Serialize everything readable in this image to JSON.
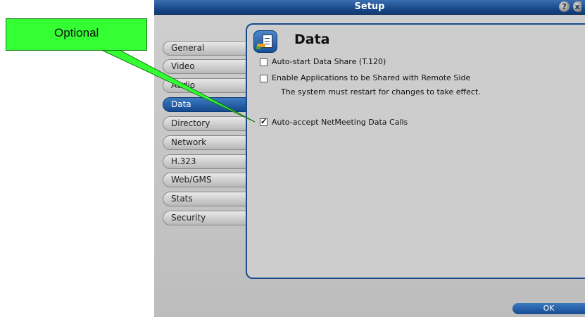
{
  "window": {
    "title": "Setup",
    "help_glyph": "?",
    "close_glyph": "x"
  },
  "sidebar": {
    "items": [
      {
        "label": "General"
      },
      {
        "label": "Video"
      },
      {
        "label": "Audio"
      },
      {
        "label": "Data",
        "active": true
      },
      {
        "label": "Directory"
      },
      {
        "label": "Network"
      },
      {
        "label": "H.323"
      },
      {
        "label": "Web/GMS"
      },
      {
        "label": "Stats"
      },
      {
        "label": "Security"
      }
    ]
  },
  "panel": {
    "title": "Data",
    "icon": "data-share-icon",
    "options": [
      {
        "label": "Auto-start Data Share (T.120)",
        "checked": false
      },
      {
        "label": "Enable Applications to be Shared with Remote Side",
        "checked": false
      },
      {
        "label": "Auto-accept NetMeeting Data Calls",
        "checked": true
      }
    ],
    "note": "The system must restart for changes to take effect."
  },
  "footer": {
    "ok_label": "OK"
  },
  "callout": {
    "label": "Optional",
    "color": "#33ff33"
  },
  "colors": {
    "accent": "#1a4a8a",
    "background": "#c4c4c4"
  }
}
